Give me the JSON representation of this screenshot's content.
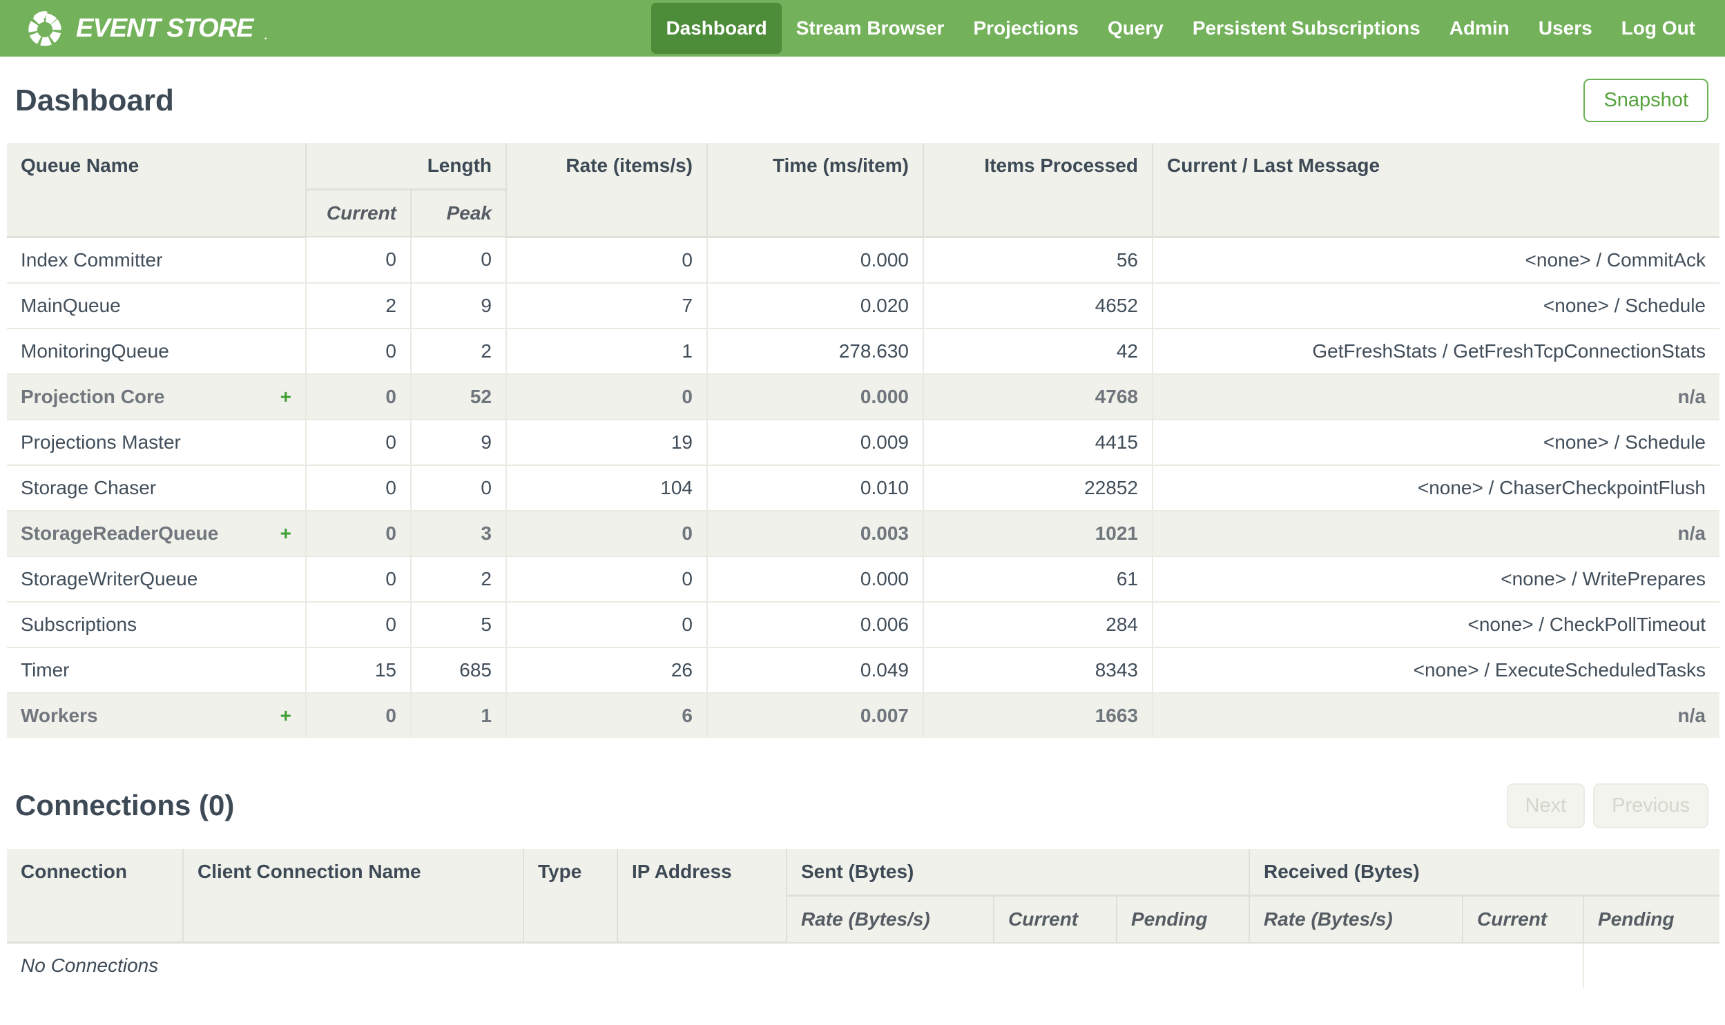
{
  "brand": {
    "name": "EVENT STORE",
    "reg_mark": ".",
    "logo_icon": "segmented-ring-logo"
  },
  "nav": {
    "items": [
      {
        "label": "Dashboard",
        "active": true
      },
      {
        "label": "Stream Browser",
        "active": false
      },
      {
        "label": "Projections",
        "active": false
      },
      {
        "label": "Query",
        "active": false
      },
      {
        "label": "Persistent Subscriptions",
        "active": false
      },
      {
        "label": "Admin",
        "active": false
      },
      {
        "label": "Users",
        "active": false
      },
      {
        "label": "Log Out",
        "active": false
      }
    ]
  },
  "page": {
    "title": "Dashboard",
    "snapshot_button": "Snapshot"
  },
  "queue_table": {
    "headers": {
      "queue_name": "Queue Name",
      "length": "Length",
      "length_current": "Current",
      "length_peak": "Peak",
      "rate": "Rate (items/s)",
      "time": "Time (ms/item)",
      "items_processed": "Items Processed",
      "message": "Current / Last Message"
    },
    "expander_glyph": "+",
    "rows": [
      {
        "name": "Index Committer",
        "expandable": false,
        "current": "0",
        "peak": "0",
        "rate": "0",
        "time": "0.000",
        "items_processed": "56",
        "message": "<none> / CommitAck"
      },
      {
        "name": "MainQueue",
        "expandable": false,
        "current": "2",
        "peak": "9",
        "rate": "7",
        "time": "0.020",
        "items_processed": "4652",
        "message": "<none> / Schedule"
      },
      {
        "name": "MonitoringQueue",
        "expandable": false,
        "current": "0",
        "peak": "2",
        "rate": "1",
        "time": "278.630",
        "items_processed": "42",
        "message": "GetFreshStats / GetFreshTcpConnectionStats"
      },
      {
        "name": "Projection Core",
        "expandable": true,
        "current": "0",
        "peak": "52",
        "rate": "0",
        "time": "0.000",
        "items_processed": "4768",
        "message": "n/a"
      },
      {
        "name": "Projections Master",
        "expandable": false,
        "current": "0",
        "peak": "9",
        "rate": "19",
        "time": "0.009",
        "items_processed": "4415",
        "message": "<none> / Schedule"
      },
      {
        "name": "Storage Chaser",
        "expandable": false,
        "current": "0",
        "peak": "0",
        "rate": "104",
        "time": "0.010",
        "items_processed": "22852",
        "message": "<none> / ChaserCheckpointFlush"
      },
      {
        "name": "StorageReaderQueue",
        "expandable": true,
        "current": "0",
        "peak": "3",
        "rate": "0",
        "time": "0.003",
        "items_processed": "1021",
        "message": "n/a"
      },
      {
        "name": "StorageWriterQueue",
        "expandable": false,
        "current": "0",
        "peak": "2",
        "rate": "0",
        "time": "0.000",
        "items_processed": "61",
        "message": "<none> / WritePrepares"
      },
      {
        "name": "Subscriptions",
        "expandable": false,
        "current": "0",
        "peak": "5",
        "rate": "0",
        "time": "0.006",
        "items_processed": "284",
        "message": "<none> / CheckPollTimeout"
      },
      {
        "name": "Timer",
        "expandable": false,
        "current": "15",
        "peak": "685",
        "rate": "26",
        "time": "0.049",
        "items_processed": "8343",
        "message": "<none> / ExecuteScheduledTasks"
      },
      {
        "name": "Workers",
        "expandable": true,
        "current": "0",
        "peak": "1",
        "rate": "6",
        "time": "0.007",
        "items_processed": "1663",
        "message": "n/a"
      }
    ]
  },
  "connections": {
    "title": "Connections (0)",
    "buttons": {
      "next": "Next",
      "previous": "Previous"
    },
    "headers": {
      "connection": "Connection",
      "client_connection_name": "Client Connection Name",
      "type": "Type",
      "ip_address": "IP Address",
      "sent": "Sent (Bytes)",
      "received": "Received (Bytes)",
      "rate": "Rate (Bytes/s)",
      "current": "Current",
      "pending": "Pending"
    },
    "empty_message": "No Connections"
  },
  "colors": {
    "nav_green": "#73b25b",
    "nav_active_green": "#4d8c38",
    "accent_green": "#55a33c",
    "expander_green": "#3f9e33",
    "header_bg": "#f0f1ea",
    "text_dark": "#3d4a56",
    "group_text": "#70767d"
  }
}
